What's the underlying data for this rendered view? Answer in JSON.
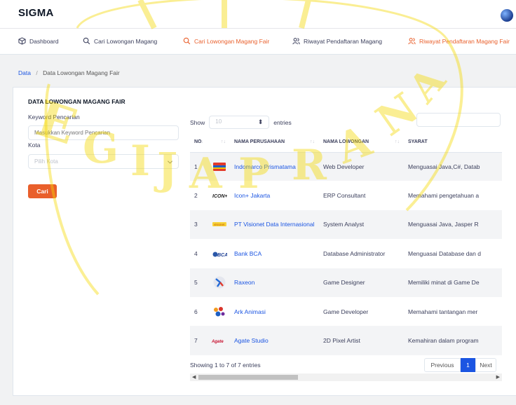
{
  "app": {
    "title": "SIGMA"
  },
  "nav": {
    "items": [
      {
        "label": "Dashboard",
        "icon": "cube-icon",
        "active": false
      },
      {
        "label": "Cari Lowongan Magang",
        "icon": "search-icon",
        "active": false
      },
      {
        "label": "Cari Lowongan Magang Fair",
        "icon": "search-icon",
        "active": true
      },
      {
        "label": "Riwayat Pendaftaran Magang",
        "icon": "users-icon",
        "active": false
      },
      {
        "label": "Riwayat Pendaftaran Magang Fair",
        "icon": "users-icon",
        "active": true
      }
    ]
  },
  "breadcrumb": {
    "root": "Data",
    "separator": "/",
    "current": "Data Lowongan Magang Fair"
  },
  "filter": {
    "title": "DATA LOWONGAN MAGANG FAIR",
    "keyword_label": "Keyword Pencarian",
    "keyword_placeholder": "Masukkan Keyword Pencarian",
    "city_label": "Kota",
    "city_placeholder": "Pilih Kota",
    "submit_label": "Cari"
  },
  "table": {
    "show_label": "Show",
    "page_size": "10",
    "entries_label": "entries",
    "columns": [
      "NO",
      "NAMA PERUSAHAAN",
      "NAMA LOWONGAN",
      "SYARAT"
    ],
    "rows": [
      {
        "no": "1",
        "company": "Indomarco Prismatama",
        "position": "Web Developer",
        "requirement": "Menguasai Java,C#, Datab",
        "logo": "indomarco-logo"
      },
      {
        "no": "2",
        "company": "Icon+ Jakarta",
        "position": "ERP Consultant",
        "requirement": "Memahami pengetahuan a",
        "logo": "iconplus-logo"
      },
      {
        "no": "3",
        "company": "PT Visionet Data Internasional",
        "position": "System Analyst",
        "requirement": "Menguasai Java, Jasper R",
        "logo": "visionet-logo"
      },
      {
        "no": "4",
        "company": "Bank BCA",
        "position": "Database Administrator",
        "requirement": "Menguasai Database dan d",
        "logo": "bca-logo"
      },
      {
        "no": "5",
        "company": "Raxeon",
        "position": "Game Designer",
        "requirement": "Memiliki minat di Game De",
        "logo": "raxeon-logo"
      },
      {
        "no": "6",
        "company": "Ark Animasi",
        "position": "Game Developer",
        "requirement": "Memahami tantangan mer",
        "logo": "arkanimasi-logo"
      },
      {
        "no": "7",
        "company": "Agate Studio",
        "position": "2D Pixel Artist",
        "requirement": "Kemahiran dalam program",
        "logo": "agate-logo"
      }
    ],
    "info": "Showing 1 to 7 of 7 entries",
    "pagination": {
      "previous": "Previous",
      "current": "1",
      "next": "Next"
    }
  },
  "colors": {
    "accent": "#e95f2b",
    "link": "#1b55e2",
    "watermark": "#f5d800"
  },
  "watermark_text": "SOEGIJAPRANATA"
}
